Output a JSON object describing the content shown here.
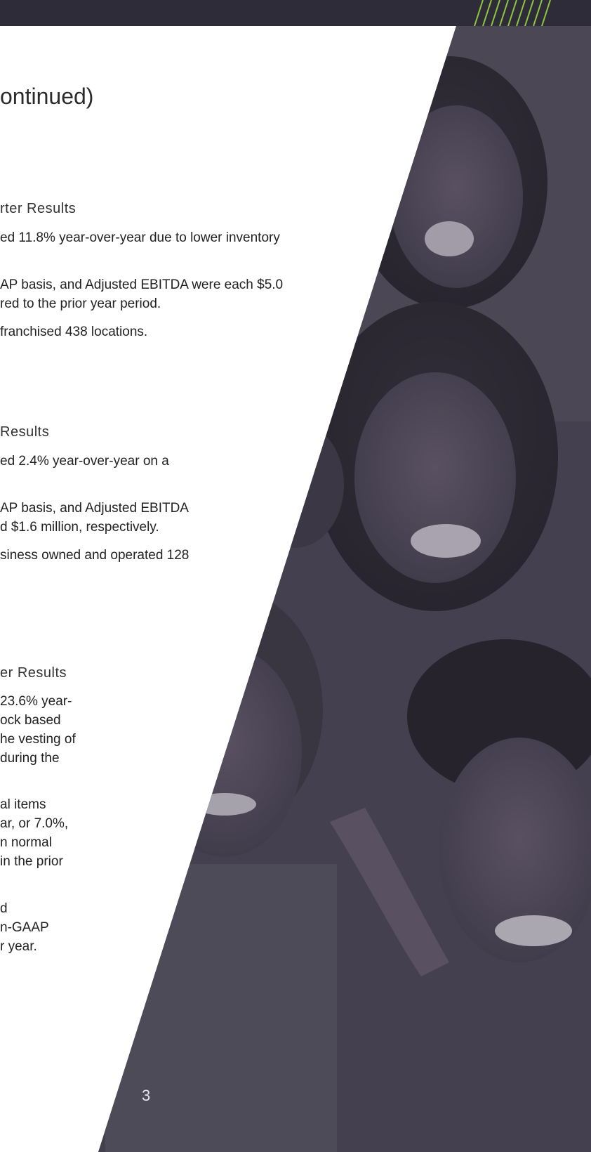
{
  "heading": "ontinued)",
  "sections": [
    {
      "subheading": "rter Results",
      "lines": [
        "ed 11.8% year-over-year due to lower inventory",
        "AP basis, and Adjusted EBITDA were each $5.0",
        "red to the prior year period.",
        "franchised 438 locations."
      ]
    },
    {
      "subheading": "Results",
      "lines": [
        "ed 2.4% year-over-year on a",
        "AP basis, and Adjusted EBITDA",
        "d $1.6 million, respectively.",
        "siness owned and operated 128"
      ]
    },
    {
      "subheading": "er Results",
      "lines": [
        "23.6% year-",
        "ock based",
        "he vesting of",
        " during the",
        "al items",
        "ar, or 7.0%,",
        "n normal",
        "in the prior",
        "d",
        "n-GAAP",
        "r year."
      ]
    }
  ],
  "page_number": "3",
  "colors": {
    "topbar": "#2f2c3a",
    "accent_stripes": "#8fc63f",
    "overlay": "#3a3646"
  }
}
